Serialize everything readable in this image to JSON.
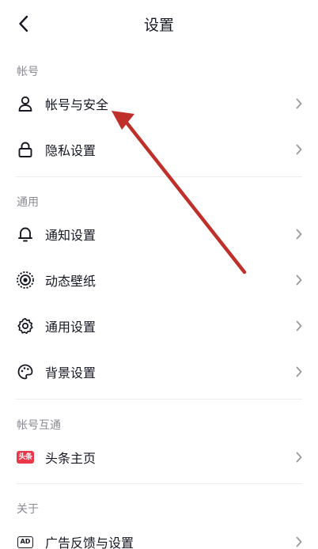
{
  "header": {
    "title": "设置"
  },
  "sections": {
    "account": {
      "label": "帐号",
      "items": [
        {
          "label": "帐号与安全",
          "icon": "user-icon"
        },
        {
          "label": "隐私设置",
          "icon": "lock-icon"
        }
      ]
    },
    "general": {
      "label": "通用",
      "items": [
        {
          "label": "通知设置",
          "icon": "bell-icon"
        },
        {
          "label": "动态壁纸",
          "icon": "live-wallpaper-icon"
        },
        {
          "label": "通用设置",
          "icon": "gear-icon"
        },
        {
          "label": "背景设置",
          "icon": "palette-icon"
        }
      ]
    },
    "interop": {
      "label": "帐号互通",
      "items": [
        {
          "label": "头条主页",
          "icon": "toutiao-icon",
          "badge": "头条"
        }
      ]
    },
    "about": {
      "label": "关于",
      "items": [
        {
          "label": "广告反馈与设置",
          "icon": "ad-icon",
          "badge": "AD"
        }
      ]
    }
  },
  "colors": {
    "text": "#161823",
    "secondary": "#8a8b91",
    "chevron": "#9a9ba0",
    "toutiao_red": "#e8384a",
    "annotation_arrow": "#c0302a"
  }
}
